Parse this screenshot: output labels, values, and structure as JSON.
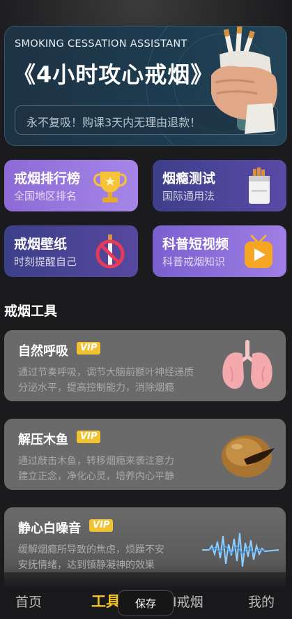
{
  "banner": {
    "subtitle": "SMOKING CESSATION ASSISTANT",
    "title": "《4小时攻心戒烟》",
    "promo_text": "永不复吸！购课3天内无理由退款！"
  },
  "features": [
    {
      "title": "戒烟排行榜",
      "subtitle": "全国地区排名",
      "icon": "trophy-icon"
    },
    {
      "title": "烟瘾测试",
      "subtitle": "国际通用法",
      "icon": "cigarette-pack-icon"
    },
    {
      "title": "戒烟壁纸",
      "subtitle": "时刻提醒自己",
      "icon": "no-smoking-icon"
    },
    {
      "title": "科普短视频",
      "subtitle": "科普戒烟知识",
      "icon": "video-play-icon"
    }
  ],
  "section_title": "戒烟工具",
  "vip_label": "VIP",
  "tools": [
    {
      "name": "自然呼吸",
      "desc1": "通过节奏呼吸，调节大脑前额叶神经递质",
      "desc2": "分泌水平，提高控制能力，消除烟瘾",
      "icon": "lungs-icon"
    },
    {
      "name": "解压木鱼",
      "desc1": "通过敲击木鱼，转移烟瘾来袭注意力",
      "desc2": "建立正念，净化心灵，培养内心平静",
      "icon": "wooden-fish-icon"
    },
    {
      "name": "静心白噪音",
      "desc1": "缓解烟瘾所导致的焦虑，烦躁不安",
      "desc2": "安抚情绪，达到镇静凝神的效果",
      "icon": "sound-wave-icon"
    }
  ],
  "nav": {
    "home": "首页",
    "tools": "工具",
    "ai": "AI戒烟",
    "mine": "我的",
    "active": "tools"
  },
  "save_button": "保存",
  "colors": {
    "accent": "#f4c324",
    "vip_badge": "#f1c232",
    "background": "#1b1b1d"
  }
}
